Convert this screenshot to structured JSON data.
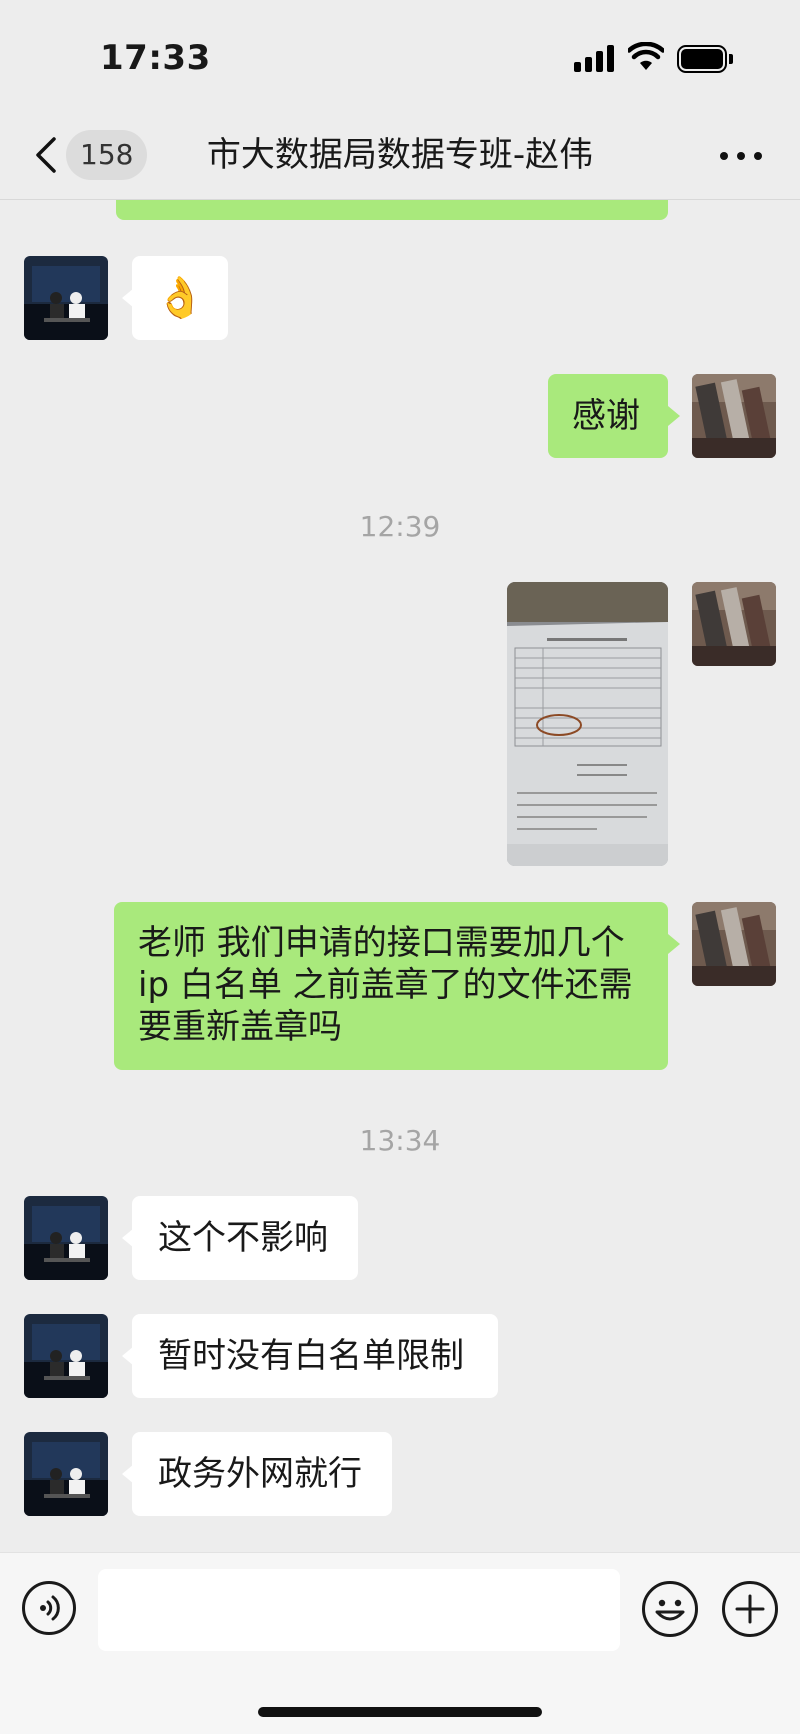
{
  "status_bar": {
    "time": "17:33"
  },
  "header": {
    "unread_count": "158",
    "title": "市大数据局数据专班-赵伟"
  },
  "messages": {
    "m2": {
      "emoji": "👌"
    },
    "m3": {
      "text": "感谢"
    },
    "ts1": {
      "text": "12:39"
    },
    "m5": {
      "text": "老师 我们申请的接口需要加几个ip 白名单 之前盖章了的文件还需要重新盖章吗"
    },
    "ts2": {
      "text": "13:34"
    },
    "m6": {
      "text": "这个不影响"
    },
    "m7": {
      "text": "暂时没有白名单限制"
    },
    "m8": {
      "text": "政务外网就行"
    }
  },
  "input": {
    "value": ""
  },
  "colors": {
    "self_bubble": "#A9E97C",
    "other_bubble": "#FFFFFF",
    "background": "#EDEDED"
  }
}
